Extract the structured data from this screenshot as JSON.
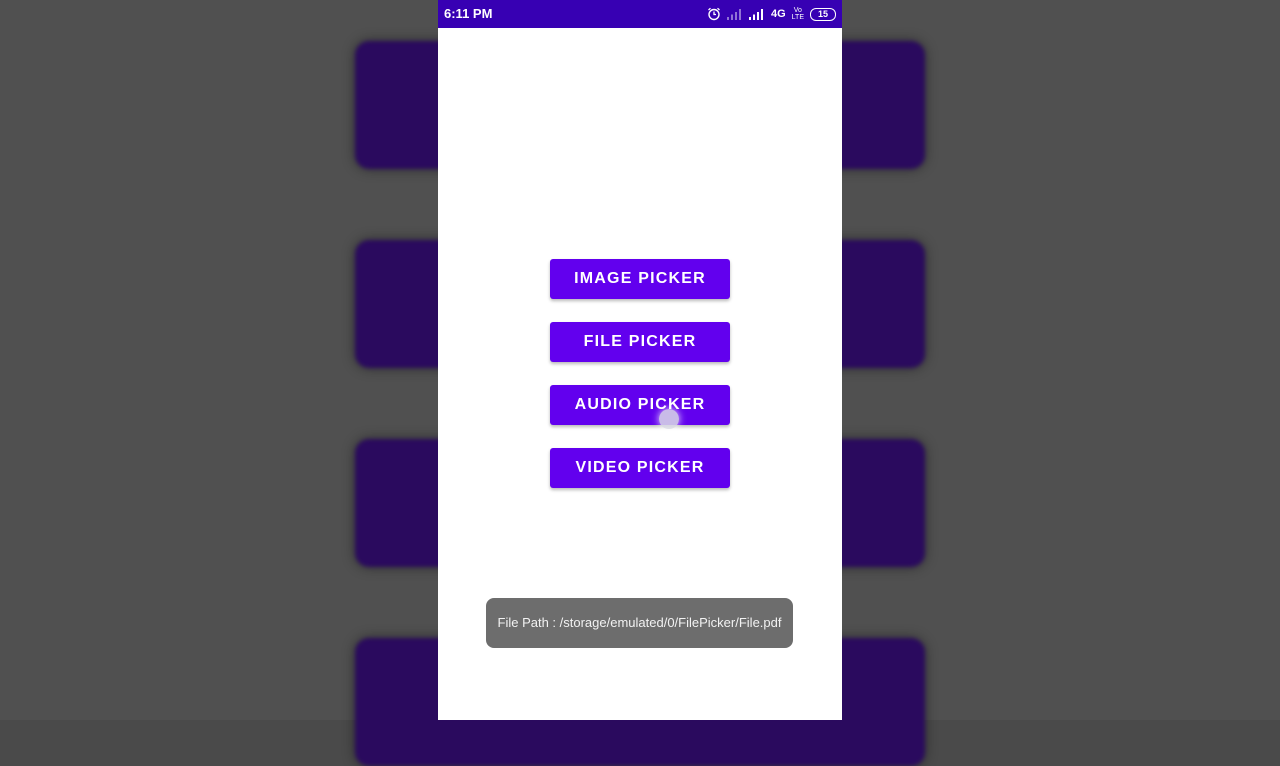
{
  "status_bar": {
    "time": "6:11 PM",
    "network": "4G",
    "volte_top": "Vo",
    "volte_bottom": "LTE",
    "battery": "15",
    "icons": [
      "alarm-icon",
      "signal-weak-icon",
      "signal-strong-icon",
      "battery-icon"
    ]
  },
  "buttons": {
    "image_picker": "IMAGE PICKER",
    "file_picker": "FILE PICKER",
    "audio_picker": "AUDIO PICKER",
    "video_picker": "VIDEO PICKER"
  },
  "toast": {
    "message": "File Path : /storage/emulated/0/FilePicker/File.pdf"
  },
  "colors": {
    "status_bar": "#3700b3",
    "button": "#6200ee",
    "toast": "#6d6d6d",
    "backdrop_card": "#2a0a5e"
  }
}
